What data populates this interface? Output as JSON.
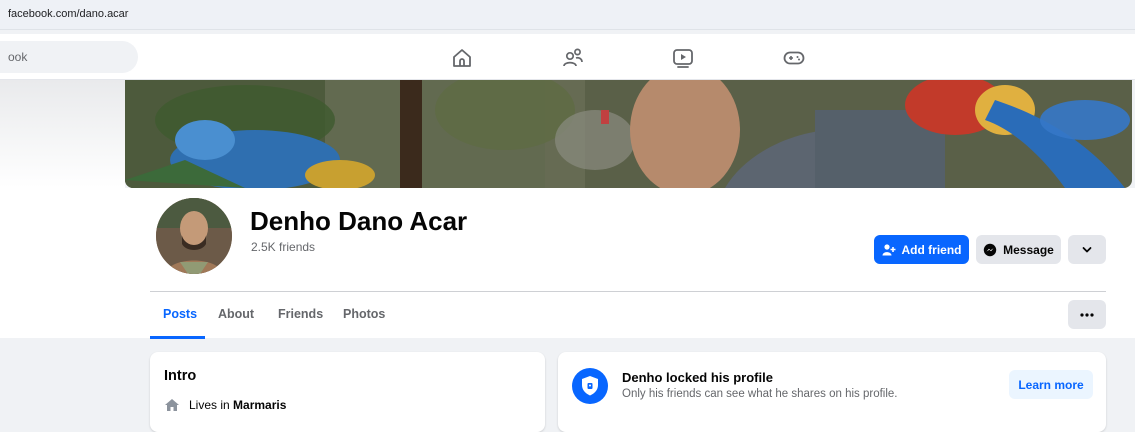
{
  "browser": {
    "url": "facebook.com/dano.acar"
  },
  "topnav": {
    "search_placeholder": "ook",
    "icons": [
      "home-icon",
      "friends-icon",
      "video-icon",
      "gaming-icon"
    ]
  },
  "profile": {
    "name": "Denho Dano Acar",
    "friends_count": "2.5K friends",
    "add_friend_label": "Add friend",
    "message_label": "Message"
  },
  "tabs": [
    {
      "label": "Posts",
      "active": true
    },
    {
      "label": "About",
      "active": false
    },
    {
      "label": "Friends",
      "active": false
    },
    {
      "label": "Photos",
      "active": false
    }
  ],
  "intro": {
    "title": "Intro",
    "lives_prefix": "Lives in ",
    "lives_place": "Marmaris"
  },
  "locked": {
    "title": "Denho locked his profile",
    "subtitle": "Only his friends can see what he shares on his profile.",
    "learn_more_label": "Learn more"
  },
  "colors": {
    "brand": "#0866ff",
    "secondary_button": "#e4e6eb",
    "background": "#f0f2f5"
  }
}
